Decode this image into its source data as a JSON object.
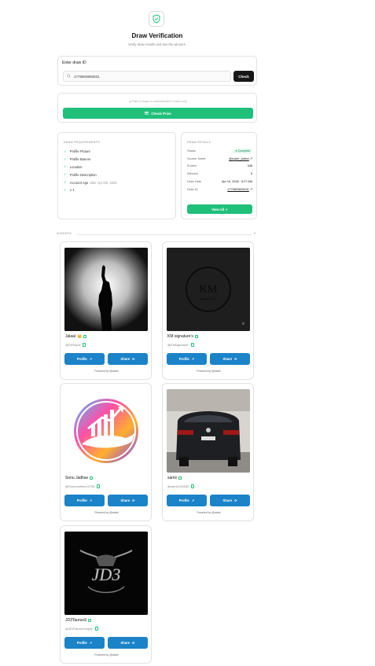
{
  "header": {
    "icon": "shield-check-icon",
    "title": "Draw Verification",
    "subtitle": "Verify draw results and see the winners."
  },
  "draw_lookup": {
    "label": "Enter draw ID",
    "value": "1775803693031",
    "button": "Check"
  },
  "prize": {
    "note": "Prize is shown to authenticated X users only",
    "button": "Check Prize"
  },
  "requirements": {
    "heading": "DRAW REQUIREMENTS",
    "items": [
      {
        "label": "Profile Picture",
        "extra": ""
      },
      {
        "label": "Profile Banner",
        "extra": ""
      },
      {
        "label": "Location",
        "extra": ""
      },
      {
        "label": "Profile Description",
        "extra": ""
      },
      {
        "label": "Account Age",
        "extra": "after Apr 9th, 2026"
      },
      {
        "label": "≥ 1",
        "extra": ""
      }
    ]
  },
  "details": {
    "heading": "DRAW DETAILS",
    "status_label": "Status",
    "status_value": "Complete",
    "tweet_label": "Source Tweet",
    "tweet_value": "@rusler_action",
    "entries_label": "Entries",
    "entries_value": "348",
    "winners_label": "Winners",
    "winners_value": "5",
    "date_label": "Draw Date",
    "date_value": "Apr 10, 2026 · 6:27 AM",
    "id_label": "Draw ID",
    "id_value": "1775803693031",
    "view_all": "View All"
  },
  "winners_section": {
    "heading": "WINNERS",
    "count": "5"
  },
  "winners": [
    {
      "name": "Jalaal",
      "badge": "👑",
      "handle": "@DrRayuli",
      "profile": "Profile",
      "share": "Share",
      "powered": "Powered by @xdabi"
    },
    {
      "name": "KM signature's",
      "badge": "",
      "handle": "@KMsignature",
      "profile": "Profile",
      "share": "Share",
      "powered": "Powered by @xdabi"
    },
    {
      "name": "Sonu Jadhav",
      "badge": "",
      "handle": "@SonuJadhav16738",
      "profile": "Profile",
      "share": "Share",
      "powered": "Powered by @xdabi"
    },
    {
      "name": "samir",
      "badge": "",
      "handle": "@samir143463",
      "profile": "Profile",
      "share": "Share",
      "powered": "Powered by @xdabi"
    },
    {
      "name": "JD3TaurusS",
      "badge": "",
      "handle": "@JD3TaurusSniper",
      "profile": "Profile",
      "share": "Share",
      "powered": "Powered by @xdabi"
    }
  ],
  "images": {
    "w1": "silhouette-raised-fist",
    "w2": "km-signature-logo",
    "w3": "bull-trading-logo",
    "w4": "black-car-rear",
    "w5": "jd3-bull-logo"
  },
  "image_text": {
    "w2_logo": "KM",
    "w2_sub": "SIGNATURE'S",
    "w5_logo": "JD3"
  },
  "colors": {
    "accent_green": "#20c07a",
    "button_blue": "#1b83c8",
    "dark_button": "#171717"
  }
}
